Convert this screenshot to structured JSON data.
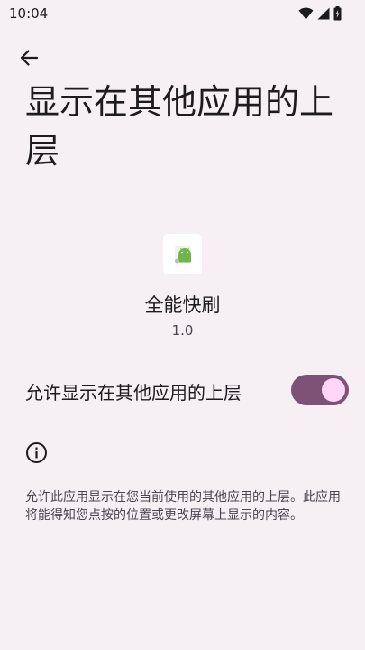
{
  "status_bar": {
    "time": "10:04"
  },
  "header": {
    "back_icon": "arrow-back-icon",
    "title": "显示在其他应用的上层"
  },
  "app": {
    "icon": "android-app-icon",
    "name": "全能快刷",
    "version": "1.0"
  },
  "permission": {
    "label": "允许显示在其他应用的上层",
    "enabled": true
  },
  "info": {
    "icon": "info-icon",
    "text": "允许此应用显示在您当前使用的其他应用的上层。此应用将能得知您点按的位置或更改屏幕上显示的内容。"
  },
  "colors": {
    "background": "#f6eff4",
    "switch_track": "#7d5276",
    "switch_thumb": "#ffd6f7",
    "text_primary": "#1d1b20",
    "text_secondary": "#49454f"
  }
}
